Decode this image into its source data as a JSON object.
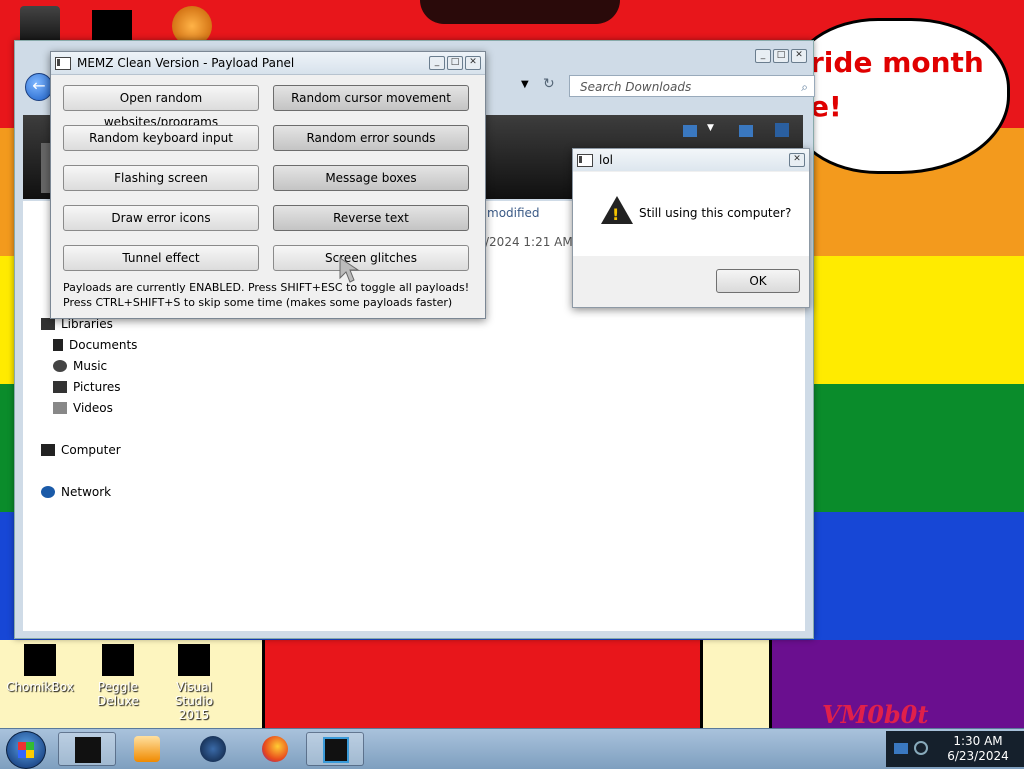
{
  "wallpaper": {
    "banner_line1": "ride month",
    "banner_line2": "e!",
    "watermark": "VM0b0t",
    "colors": {
      "red": "#e8161b",
      "orange": "#f39a1d",
      "yellow": "#ffeb00",
      "green": "#0a8c2b",
      "blue": "#1747d6",
      "purple": "#6a0f8f"
    }
  },
  "desktop_icons": [
    {
      "label": "ChomikBox"
    },
    {
      "label": "Peggle Deluxe"
    },
    {
      "label": "Visual Studio 2015"
    }
  ],
  "explorer": {
    "search_placeholder": "Search Downloads",
    "column_modified": "modified",
    "row_date": "/2024 1:21 AM",
    "nav": {
      "libraries": "Libraries",
      "documents": "Documents",
      "music": "Music",
      "pictures": "Pictures",
      "videos": "Videos",
      "computer": "Computer",
      "network": "Network"
    }
  },
  "memz": {
    "title": "MEMZ Clean Version - Payload Panel",
    "buttons": [
      {
        "label": "Open random websites/programs",
        "enabled": false
      },
      {
        "label": "Random cursor movement",
        "enabled": true
      },
      {
        "label": "Random keyboard input",
        "enabled": false
      },
      {
        "label": "Random error sounds",
        "enabled": true
      },
      {
        "label": "Flashing screen",
        "enabled": false
      },
      {
        "label": "Message boxes",
        "enabled": true
      },
      {
        "label": "Draw error icons",
        "enabled": false
      },
      {
        "label": "Reverse text",
        "enabled": true
      },
      {
        "label": "Tunnel effect",
        "enabled": false
      },
      {
        "label": "Screen glitches",
        "enabled": false
      }
    ],
    "info_line1": "Payloads are currently ENABLED. Press SHIFT+ESC to toggle all payloads!",
    "info_line2": "Press CTRL+SHIFT+S to skip some time (makes some payloads faster)"
  },
  "dialog": {
    "title": "lol",
    "message": "Still using this computer?",
    "ok_label": "OK",
    "icon": "warning-icon"
  },
  "taskbar": {
    "time": "1:30 AM",
    "date": "6/23/2024",
    "apps": [
      "explorer-icon",
      "media-player-icon",
      "globe-icon",
      "firefox-icon",
      "memz-icon"
    ]
  }
}
